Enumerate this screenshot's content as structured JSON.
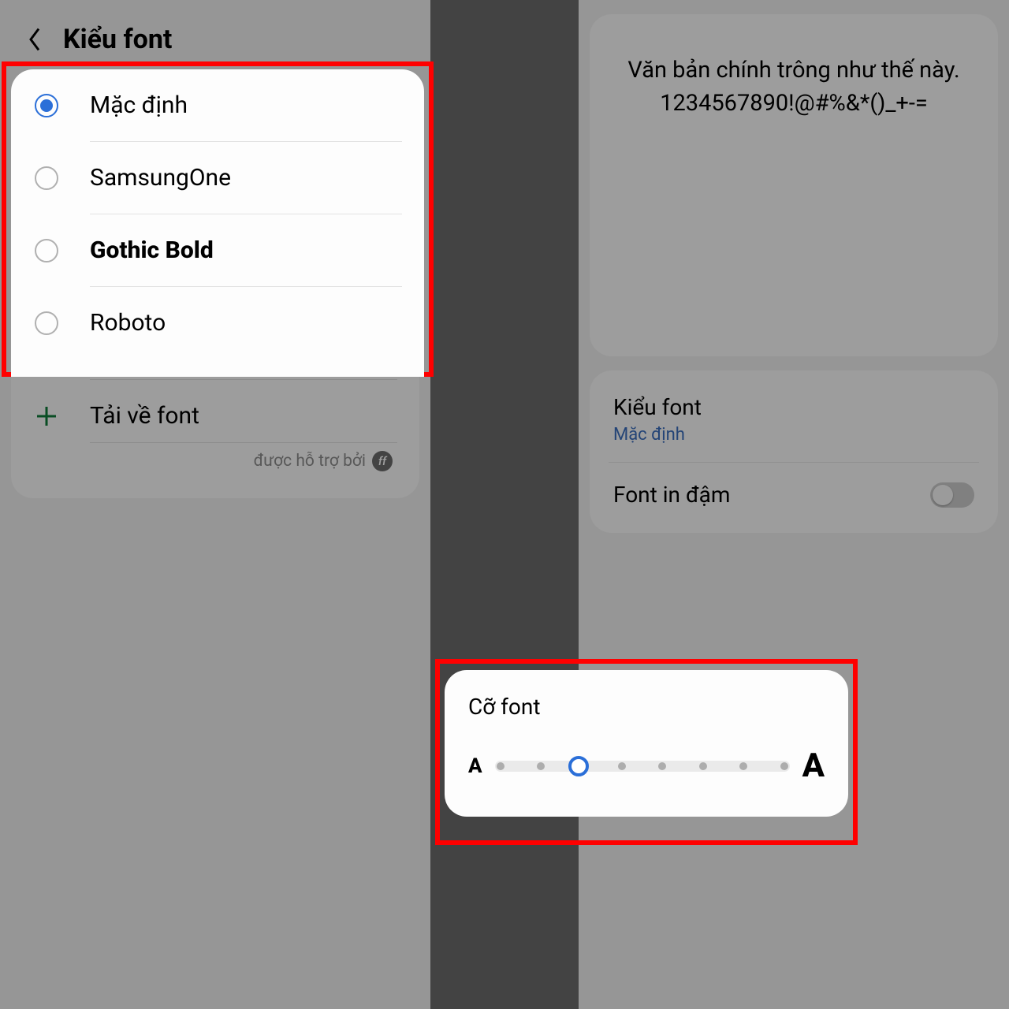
{
  "left": {
    "back_icon": "back-chevron-icon",
    "title": "Kiểu font",
    "fonts": [
      {
        "label": "Mặc định",
        "selected": true,
        "bold": false
      },
      {
        "label": "SamsungOne",
        "selected": false,
        "bold": false
      },
      {
        "label": "Gothic Bold",
        "selected": false,
        "bold": true
      },
      {
        "label": "Roboto",
        "selected": false,
        "bold": false
      }
    ],
    "download_label": "Tải về font",
    "supported_by": "được hỗ trợ bởi",
    "supported_badge": "ff"
  },
  "right": {
    "preview_line1": "Văn bản chính trông như thế này.",
    "preview_line2": "1234567890!@#%&*()_+-=",
    "font_style_title": "Kiểu font",
    "font_style_value": "Mặc định",
    "bold_label": "Font in đậm",
    "bold_on": false,
    "size_title": "Cỡ font",
    "size_small": "A",
    "size_large": "A",
    "size_steps": 8,
    "size_index": 2
  }
}
